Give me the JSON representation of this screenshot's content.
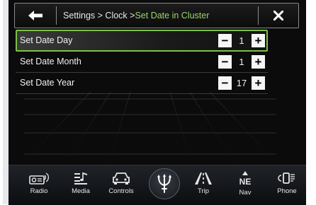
{
  "header": {
    "crumb_path": "Settings > Clock > ",
    "crumb_current": "Set Date in Cluster"
  },
  "rows": [
    {
      "label": "Set Date Day",
      "value": "1",
      "minus": "−",
      "plus": "+",
      "selected": true
    },
    {
      "label": "Set Date Month",
      "value": "1",
      "minus": "−",
      "plus": "+",
      "selected": false
    },
    {
      "label": "Set Date Year",
      "value": "17",
      "minus": "−",
      "plus": "+",
      "selected": false
    }
  ],
  "nav": [
    {
      "label": "Radio",
      "icon": "radio-icon"
    },
    {
      "label": "Media",
      "icon": "media-icon"
    },
    {
      "label": "Controls",
      "icon": "controls-icon"
    },
    {
      "label": "",
      "icon": "trident-logo-icon"
    },
    {
      "label": "Trip",
      "icon": "trip-icon"
    },
    {
      "label": "Nav",
      "icon": "nav-icon",
      "badge": "NE"
    },
    {
      "label": "Phone",
      "icon": "phone-icon"
    }
  ],
  "colors": {
    "accent": "#7dc243",
    "crumb_current": "#9ad46a",
    "background": "#0b0b0b"
  }
}
